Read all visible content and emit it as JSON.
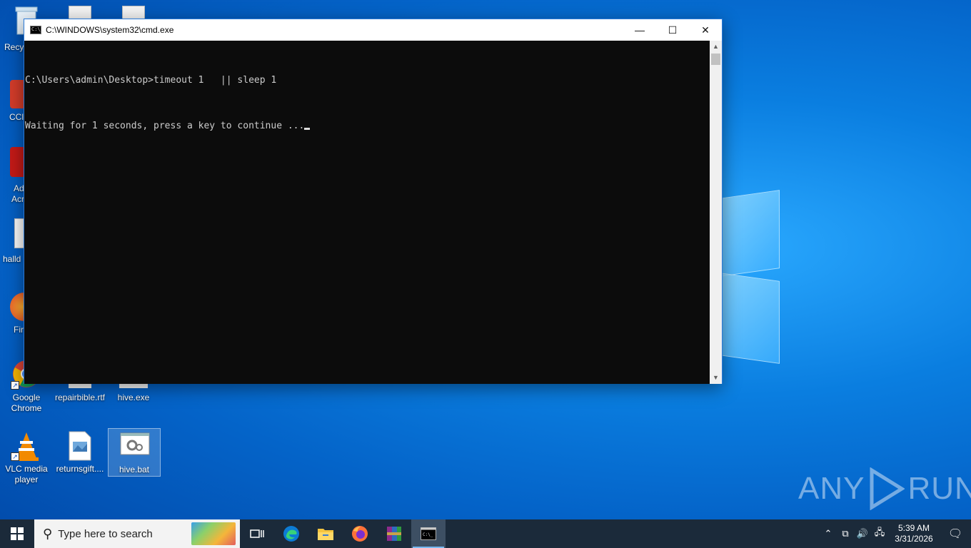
{
  "desktop": {
    "partial_labels": [
      "Recy",
      "CCl",
      "Ad",
      "Acr",
      "halld",
      "Fir"
    ],
    "icons": [
      {
        "label_line1": "Google",
        "label_line2": "Chrome"
      },
      {
        "label_line1": "repairbible.rtf",
        "label_line2": ""
      },
      {
        "label_line1": "hive.exe",
        "label_line2": ""
      },
      {
        "label_line1": "VLC media",
        "label_line2": "player"
      },
      {
        "label_line1": "returnsgift....",
        "label_line2": ""
      },
      {
        "label_line1": "hive.bat",
        "label_line2": ""
      }
    ]
  },
  "cmd_window": {
    "title": "C:\\WINDOWS\\system32\\cmd.exe",
    "icon_text": "C:\\_",
    "minimize": "—",
    "maximize": "☐",
    "close": "✕",
    "lines": [
      "C:\\Users\\admin\\Desktop>timeout 1   || sleep 1",
      "Waiting for 1 seconds, press a key to continue ..."
    ],
    "scroll_up": "▲",
    "scroll_down": "▼"
  },
  "watermark": {
    "left": "ANY",
    "right": "RUN"
  },
  "taskbar": {
    "search_placeholder": "Type here to search",
    "clock_time": "5:39 AM",
    "clock_date": "3/31/2026",
    "icons": [
      "task-view-icon",
      "edge-icon",
      "file-explorer-icon",
      "firefox-icon",
      "winrar-icon",
      "cmd-icon"
    ]
  },
  "colors": {
    "taskbar": "#1b2a3a",
    "console_bg": "#0c0c0c",
    "console_fg": "#cccccc",
    "desktop": "#0a7ee0"
  }
}
